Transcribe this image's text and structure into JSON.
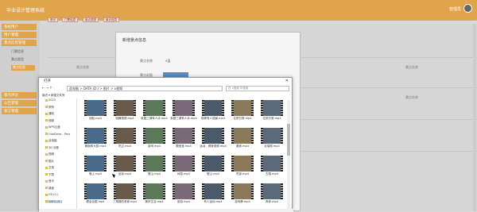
{
  "app": {
    "brand": "毕业设计管理系统",
    "user": "管理员"
  },
  "sidebar": {
    "menus": [
      {
        "label": "系统用户"
      },
      {
        "label": "用户管理"
      },
      {
        "label": "景点信息管理"
      },
      {
        "label": "景点评论"
      },
      {
        "label": "公告管理"
      },
      {
        "label": "留言管理"
      }
    ],
    "subs": [
      {
        "label": "门票信息"
      },
      {
        "label": "景点类型"
      },
      {
        "label": "景点信息"
      }
    ]
  },
  "tabs": [
    {
      "label": "首页"
    },
    {
      "label": "门票信息"
    },
    {
      "label": "景点类型"
    },
    {
      "label": "景点信息"
    }
  ],
  "table": {
    "col1": "景点名称",
    "values": [
      "景点名称",
      "景点名称",
      "景点名称",
      "景点名称"
    ]
  },
  "dialog": {
    "title": "新增景点信息",
    "field1_label": "景点名称",
    "field1_value": "x值",
    "field2_label": "景点封面"
  },
  "filedialog": {
    "title": "打开",
    "path": "此电脑 > DATA (D:) > 图片 > x视频",
    "search_placeholder": "在 x视频 中搜索",
    "organize": "组织 ▾  新建文件夹",
    "tree": [
      {
        "label": "2023"
      },
      {
        "label": "采购"
      },
      {
        "label": "通知"
      },
      {
        "label": "视频"
      },
      {
        "label": "WPS云盘"
      },
      {
        "label": "OneDrive - Pers"
      },
      {
        "label": "此电脑"
      },
      {
        "label": "3D 对象"
      },
      {
        "label": "视频"
      },
      {
        "label": "图片"
      },
      {
        "label": "文档"
      },
      {
        "label": "下载"
      },
      {
        "label": "音乐"
      },
      {
        "label": "桌面"
      },
      {
        "label": "OS (C:)"
      },
      {
        "label": "DATA (D:)"
      }
    ],
    "files": [
      "划船.mp4",
      "跳舞视频.mp4",
      "秋园三湖有人泳.mp4",
      "秋园三湖有人泳.mp4",
      "宿雾有人观景.mp4",
      "住院日常.mp4",
      "住院日常.mp4",
      "晚饭和大厨.mp4",
      "吃过.mp4",
      "游戏.mp4",
      "跟宝宝.mp4",
      "运动、健身视频.mp4",
      "搬家.mp4",
      "北瑞爬.mp4",
      "晚上.mp4",
      "运动.mp4",
      "登山.mp4",
      "休息.mp4",
      "登山.mp4",
      "吃饭.mp4",
      "古城.mp4",
      "看会议图.mp4",
      "三角楼的老家.mp4",
      "美好生活.mp4",
      "旅游.mp4",
      "有人运动.mp4",
      "游戏蜂.mp4",
      "奔奔.mp4"
    ]
  }
}
